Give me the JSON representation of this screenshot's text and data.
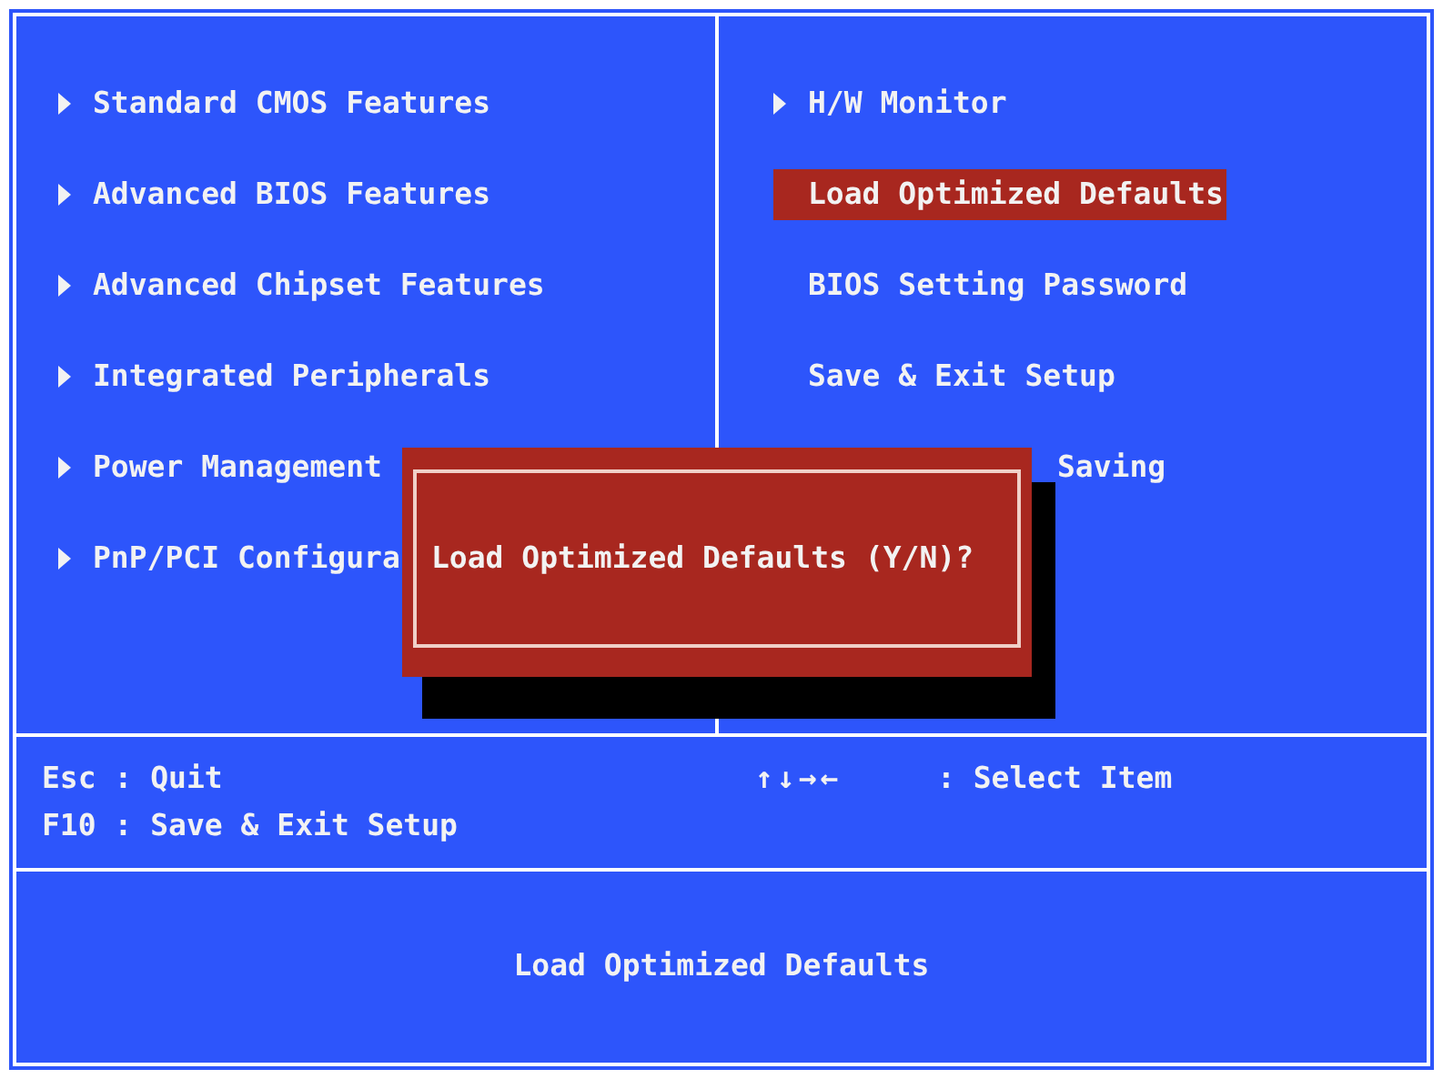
{
  "menu_left": [
    {
      "label": "Standard CMOS Features",
      "arrow": true,
      "selected": false,
      "kind": "full"
    },
    {
      "label": "Advanced BIOS Features",
      "arrow": true,
      "selected": false,
      "kind": "full"
    },
    {
      "label": "Advanced Chipset Features",
      "arrow": true,
      "selected": false,
      "kind": "full"
    },
    {
      "label": "Integrated Peripherals",
      "arrow": true,
      "selected": false,
      "kind": "full"
    },
    {
      "label": "Power Management",
      "arrow": true,
      "selected": false,
      "kind": "full"
    },
    {
      "label": "PnP/PCI Configura",
      "arrow": true,
      "selected": false,
      "kind": "full"
    }
  ],
  "menu_right": [
    {
      "label": "H/W Monitor",
      "arrow": true,
      "selected": false,
      "kind": "full"
    },
    {
      "label": "Load Optimized Defaults",
      "arrow": false,
      "selected": true,
      "kind": "full"
    },
    {
      "label": "BIOS Setting Password",
      "arrow": false,
      "selected": false,
      "kind": "full"
    },
    {
      "label": "Save & Exit Setup",
      "arrow": false,
      "selected": false,
      "kind": "full"
    },
    {
      "label": "Saving",
      "arrow": false,
      "selected": false,
      "kind": "partial"
    }
  ],
  "dialog": {
    "message": "Load Optimized Defaults (Y/N)?"
  },
  "help": {
    "left": [
      "Esc : Quit",
      "F10 : Save & Exit Setup"
    ],
    "keys": "↑↓→←",
    "keys_desc": ": Select Item"
  },
  "status_bar": "Load Optimized Defaults"
}
